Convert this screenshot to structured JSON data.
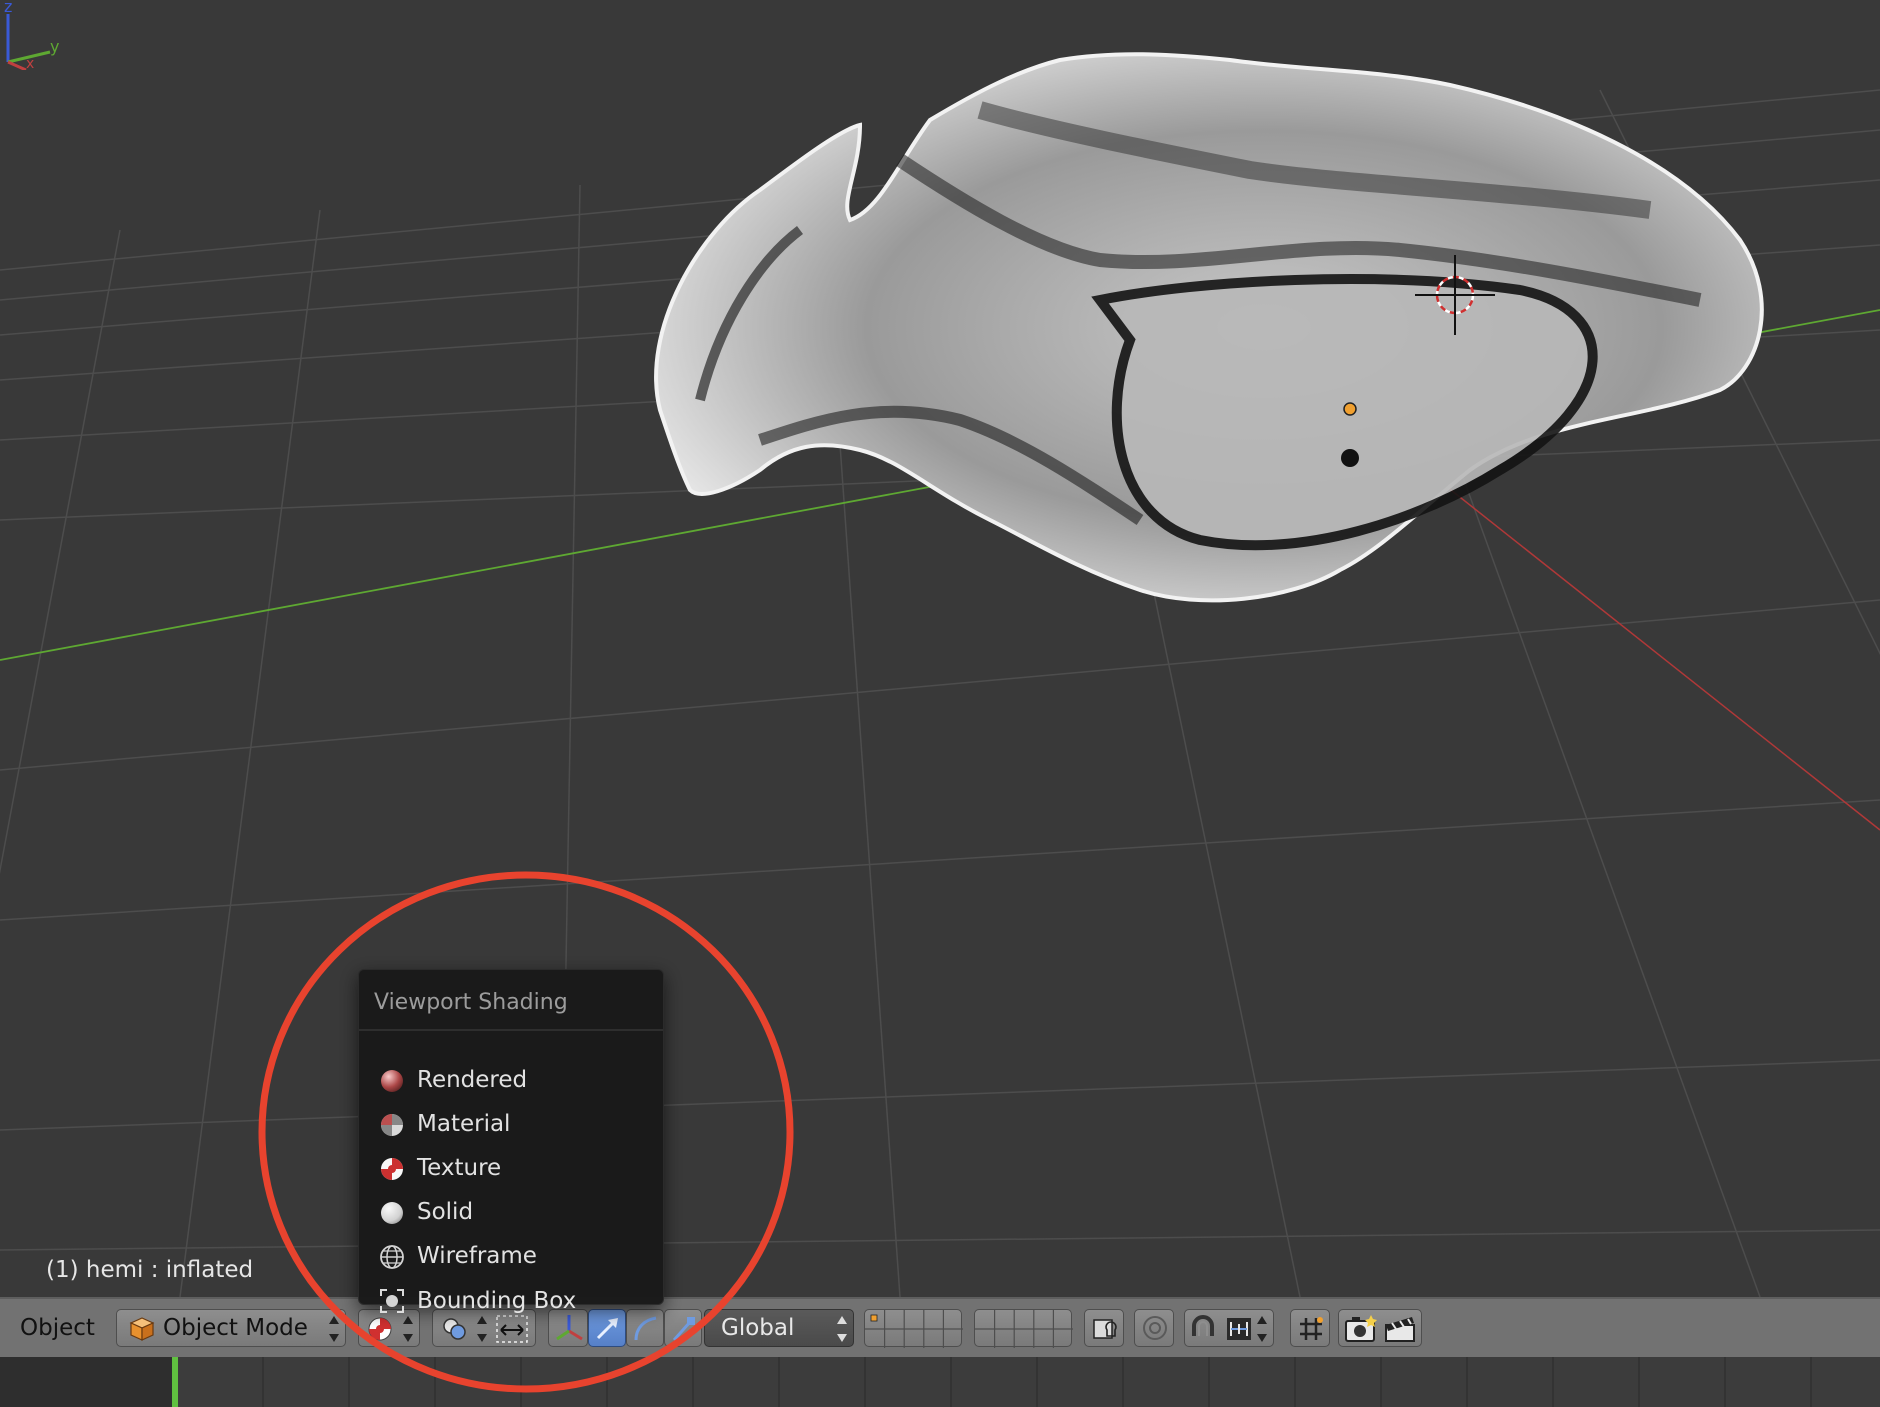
{
  "viewport": {
    "status_text": "(1) hemi : inflated",
    "axis_labels": {
      "z": "z",
      "y": "y",
      "x": "x"
    }
  },
  "shading_menu": {
    "title": "Viewport Shading",
    "items": [
      {
        "label": "Rendered",
        "icon": "rendered-sphere-icon"
      },
      {
        "label": "Material",
        "icon": "material-sphere-icon"
      },
      {
        "label": "Texture",
        "icon": "texture-checker-icon"
      },
      {
        "label": "Solid",
        "icon": "solid-sphere-icon"
      },
      {
        "label": "Wireframe",
        "icon": "wireframe-globe-icon"
      },
      {
        "label": "Bounding Box",
        "icon": "bounding-box-icon"
      }
    ]
  },
  "header": {
    "menu_object": "Object",
    "mode_label": "Object Mode",
    "orientation_label": "Global"
  },
  "colors": {
    "annotation": "#e8432e",
    "active_button": "#5680c8",
    "x_axis": "#b03838",
    "y_axis": "#5ea832"
  }
}
